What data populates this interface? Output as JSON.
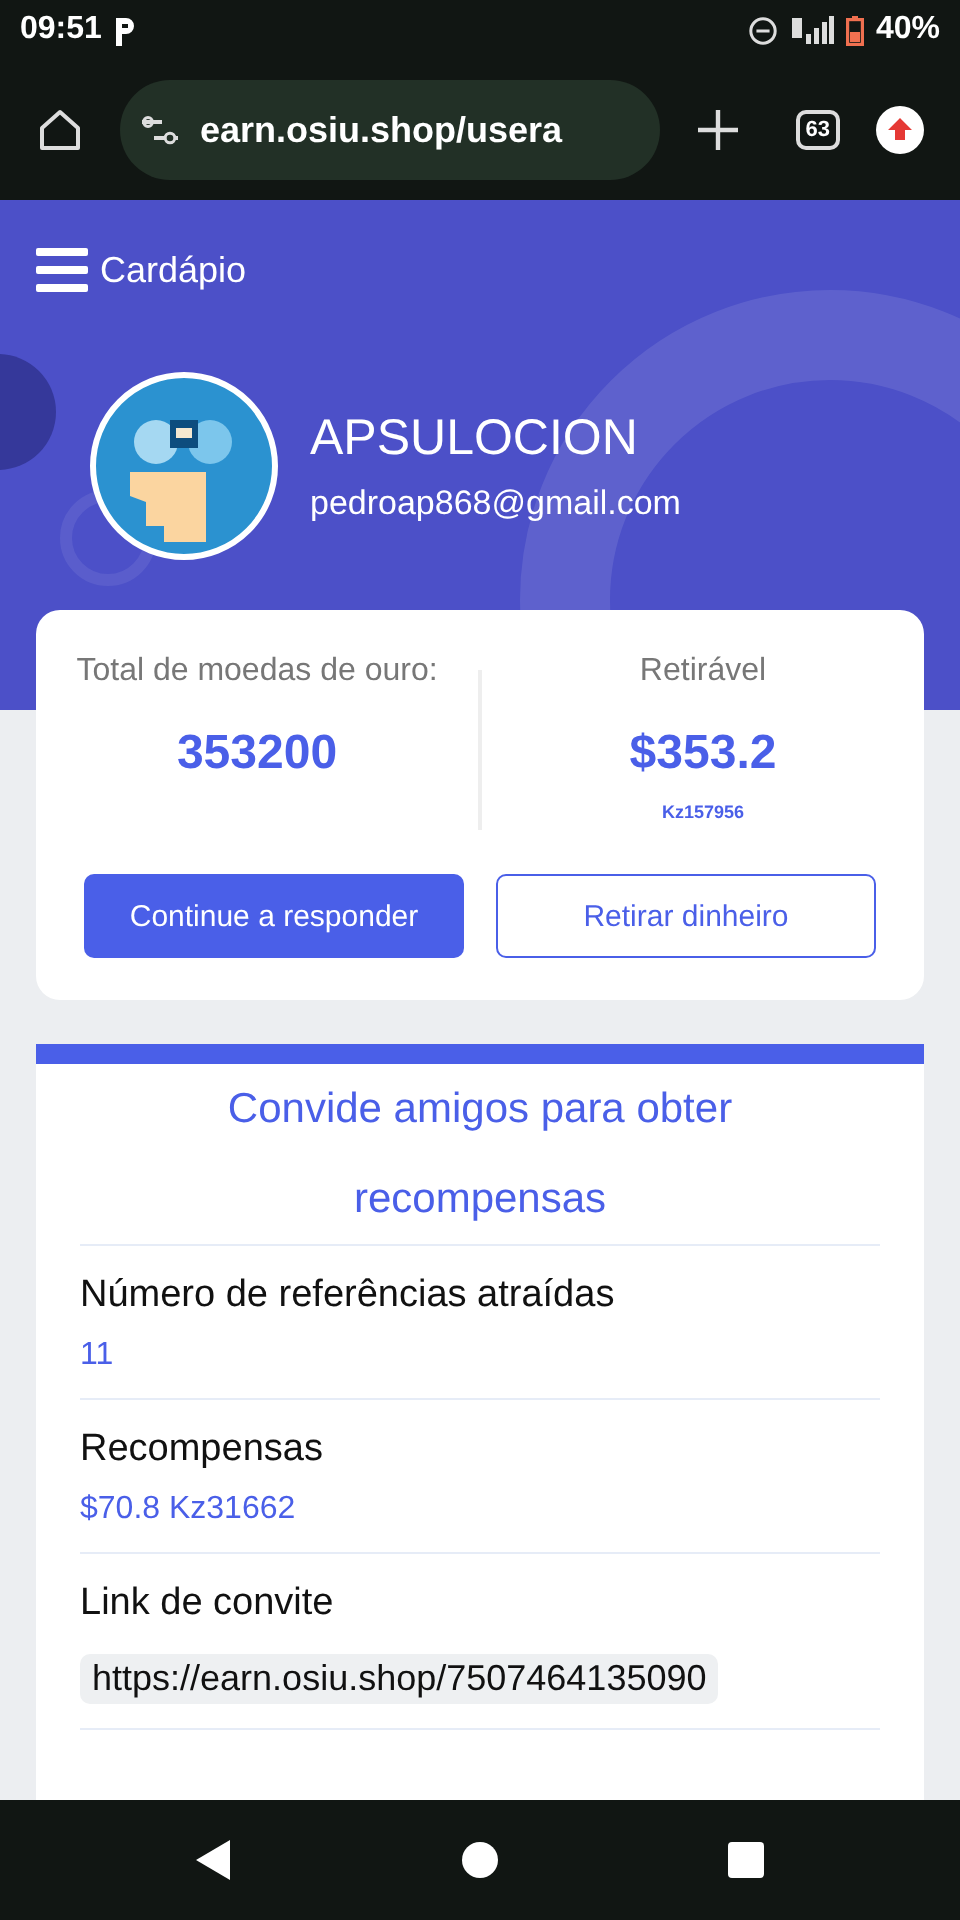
{
  "status_bar": {
    "time": "09:51",
    "battery": "40%"
  },
  "browser": {
    "url": "earn.osiu.shop/usera",
    "tab_count": "63"
  },
  "header": {
    "menu_label": "Cardápio",
    "username": "APSULOCION",
    "email": "pedroap868@gmail.com"
  },
  "balance": {
    "coins_label": "Total de moedas de ouro:",
    "coins": "353200",
    "withdrawable_label": "Retirável",
    "withdrawable": "$353.2",
    "withdrawable_local": "Kz157956",
    "buttons": [
      {
        "label": "Continue a responder",
        "kind": "primary"
      },
      {
        "label": "Retirar dinheiro",
        "kind": "outline"
      }
    ]
  },
  "invite": {
    "title": "Convide amigos para obter recompensas",
    "rows": [
      {
        "label": "Número de referências atraídas",
        "value": "11",
        "kind": "value"
      },
      {
        "label": "Recompensas",
        "value": "$70.8 Kz31662",
        "kind": "value"
      },
      {
        "label": "Link de convite",
        "value": "https://earn.osiu.shop/7507464135090",
        "kind": "link"
      }
    ]
  }
}
